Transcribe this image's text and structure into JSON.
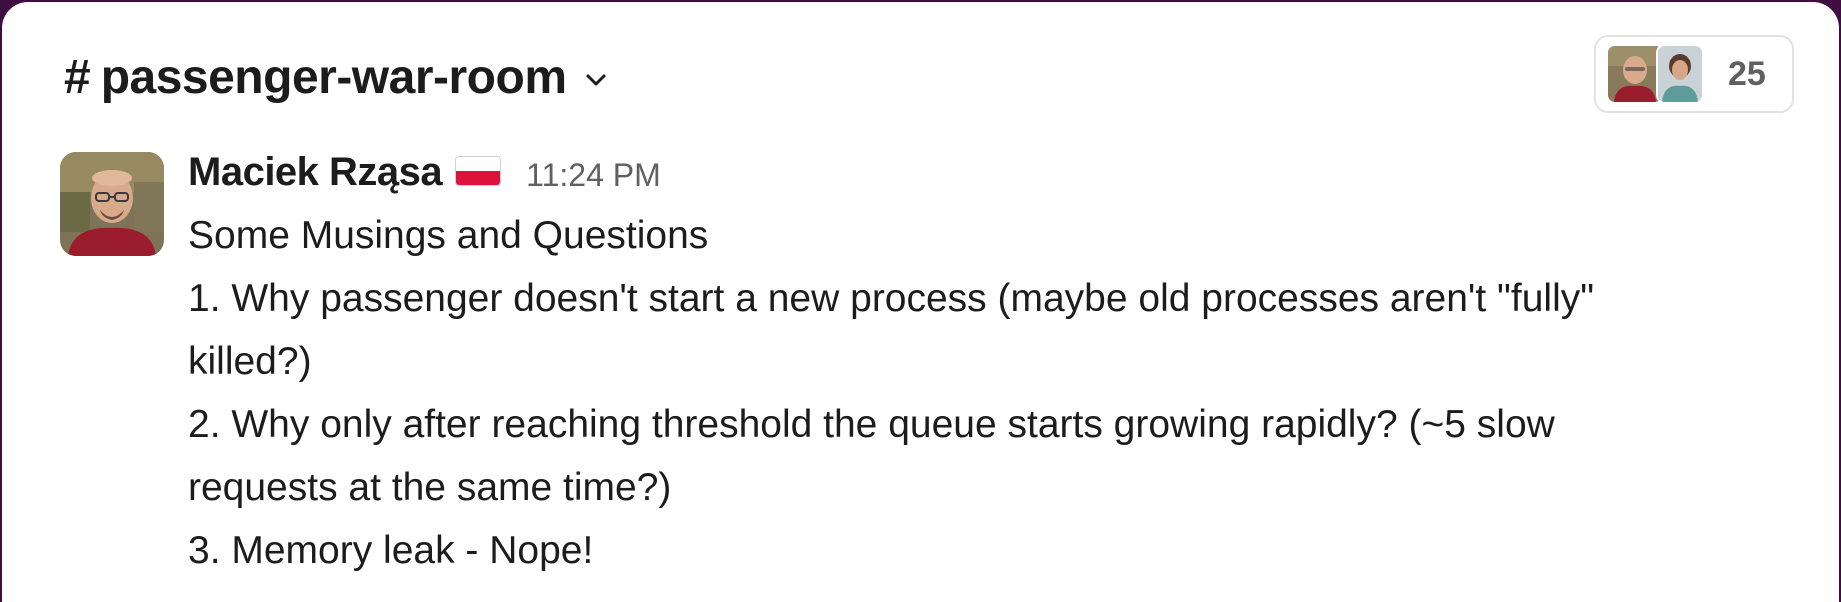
{
  "channel": {
    "prefix": "#",
    "name": "passenger-war-room",
    "dropdown_icon": "chevron-down-icon"
  },
  "members": {
    "count": "25",
    "avatars": [
      "member-avatar-1",
      "member-avatar-2"
    ]
  },
  "message": {
    "author": "Maciek Rząsa",
    "status_emoji": "flag-poland-icon",
    "timestamp": "11:24 PM",
    "lines": [
      "Some Musings and Questions",
      "1. Why passenger doesn't start a new process (maybe old processes aren't \"fully\"",
      "killed?)",
      "2. Why only after reaching threshold the queue starts growing rapidly? (~5 slow",
      "requests at the same time?)",
      "3. Memory leak - Nope!"
    ]
  },
  "colors": {
    "background": "#3f0e40",
    "surface": "#ffffff",
    "text": "#1d1c1d",
    "muted": "#616061"
  }
}
